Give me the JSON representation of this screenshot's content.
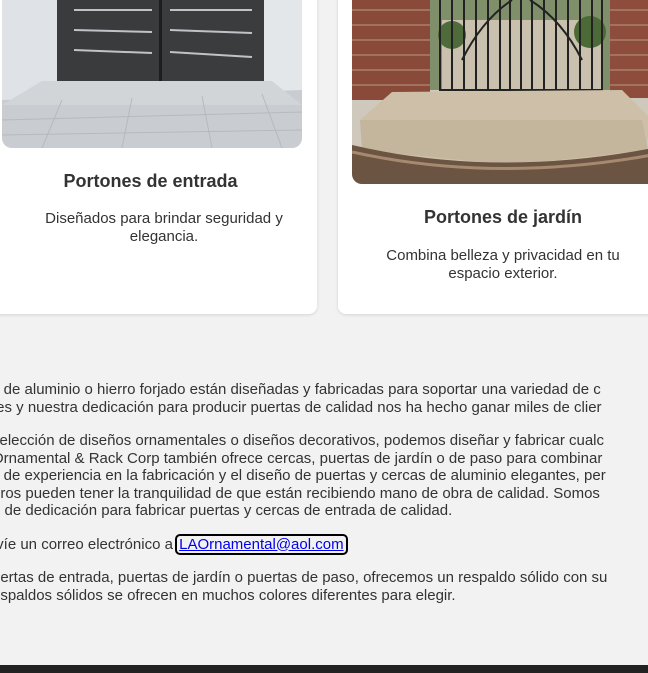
{
  "cards": [
    {
      "title": "Portones de entrada",
      "description": "Diseñados para brindar seguridad y elegancia."
    },
    {
      "title": "Portones de jardín",
      "description": "Combina belleza y privacidad en tu espacio exterior."
    }
  ],
  "about": {
    "p1_line1": "s de aluminio o hierro forjado están diseñadas y fabricadas para soportar una variedad de c",
    "p1_line2": "tes y nuestra dedicación para producir puertas de calidad nos ha hecho ganar miles de clier",
    "p2_line1": "selección de diseños ornamentales o diseños decorativos, podemos diseñar y fabricar cualc",
    "p2_line2": "Ornamental & Rack Corp también ofrece cercas, puertas de jardín o de paso para combinar",
    "p2_line3": "s de experiencia en la fabricación y el diseño de puertas y cercas de aluminio elegantes, per",
    "p2_line4": "uros pueden tener la tranquilidad de que están recibiendo mano de obra de calidad. Somos",
    "p2_line5": "o de dedicación para fabricar puertas y cercas de entrada de calidad.",
    "p3_prefix": "ıvíe un correo electrónico a ",
    "email": "LAOrnamental@aol.com",
    "p4_line1": "uertas de entrada, puertas de jardín o puertas de paso, ofrecemos un respaldo sólido con su",
    "p4_line2": "espaldos sólidos se ofrecen en muchos colores diferentes para elegir."
  },
  "colors": {
    "page_background": "#f2f2f2",
    "card_background": "#ffffff",
    "link": "#0000ee",
    "footer": "#222222"
  }
}
